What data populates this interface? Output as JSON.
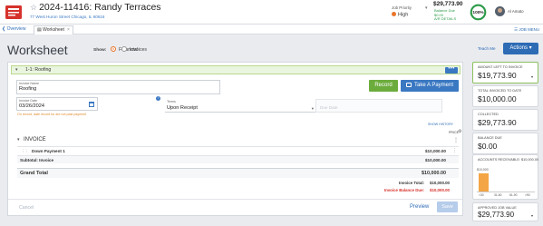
{
  "header": {
    "title": "2024-11416: Randy Terraces",
    "address": "77 West Huron Street Chicago, IL 60616",
    "priority_label": "Job Priority",
    "priority_value": "High",
    "amount": "$29,773.90",
    "balance_label": "Balance Due",
    "balance_value": "$0.00",
    "ar_details": "A/R DETAILS",
    "progress_text": "100%",
    "progress_value": 1.0,
    "user_name": "Al Amato",
    "accent": "#2d6bb5",
    "priority_color": "#e8742a",
    "progress_color": "#2c9a48"
  },
  "tabs": {
    "overview": "Overview",
    "worksheet": "Worksheet",
    "close": "×",
    "job_menu": "JOB MENU"
  },
  "page": {
    "title": "Worksheet",
    "show_label": "Show:",
    "radio_financial": "Financial",
    "radio_invoices": "Invoices",
    "teach_me": "Teach Me",
    "actions": "Actions"
  },
  "invoice_form": {
    "section_title": "1-1: Roofing",
    "more": "•••",
    "name_label": "Invoice Name",
    "name_value": "Roofing",
    "date_label": "Invoice Date",
    "date_value": "03/26/2024",
    "terms_label": "Terms",
    "terms_value": "Upon Receipt",
    "due_placeholder": "Due Date",
    "warning": "On record, date record for are not past payment",
    "record_button": "Record",
    "payment_button": "Take A Payment",
    "show_history": "SHOW HISTORY"
  },
  "invoice_table": {
    "price_header": "PRICE",
    "section_title": "INVOICE",
    "items": [
      {
        "label": "Down Payment 1",
        "amount": "$10,000.00"
      }
    ],
    "subtotal_label": "Subtotal: Invoice",
    "subtotal_amount": "$10,000.00",
    "grand_total_label": "Grand Total",
    "grand_total_amount": "$10,000.00",
    "invoice_total_label": "Invoice Total:",
    "invoice_total_amount": "$10,000.00",
    "balance_due_label": "Invoice Balance Due:",
    "balance_due_amount": "$10,000.00"
  },
  "footer": {
    "cancel": "Cancel",
    "preview": "Preview",
    "save": "Save"
  },
  "stats": {
    "amount_left_label": "AMOUNT LEFT TO INVOICE",
    "amount_left_value": "$19,773.90",
    "total_invoiced_label": "TOTAL INVOICED TO DATE",
    "total_invoiced_value": "$10,000.00",
    "collected_label": "COLLECTED",
    "collected_value": "$29,773.90",
    "balance_label": "BALANCE DUE",
    "balance_value": "$0.00",
    "ar_label": "ACCOUNTS RECEIVABLE: $10,000.00",
    "approved_label": "APPROVED JOB VALUE",
    "approved_value": "$29,773.90"
  },
  "chart_data": {
    "type": "bar",
    "title": "ACCOUNTS RECEIVABLE: $10,000.00",
    "categories": [
      "<30",
      "31-60",
      "61-90",
      ">90"
    ],
    "values": [
      10000,
      0,
      0,
      0
    ],
    "data_labels": [
      "$10,000",
      "",
      "",
      ""
    ],
    "ylim": [
      0,
      10000
    ],
    "bar_color": "#f4a545",
    "grid": false
  }
}
